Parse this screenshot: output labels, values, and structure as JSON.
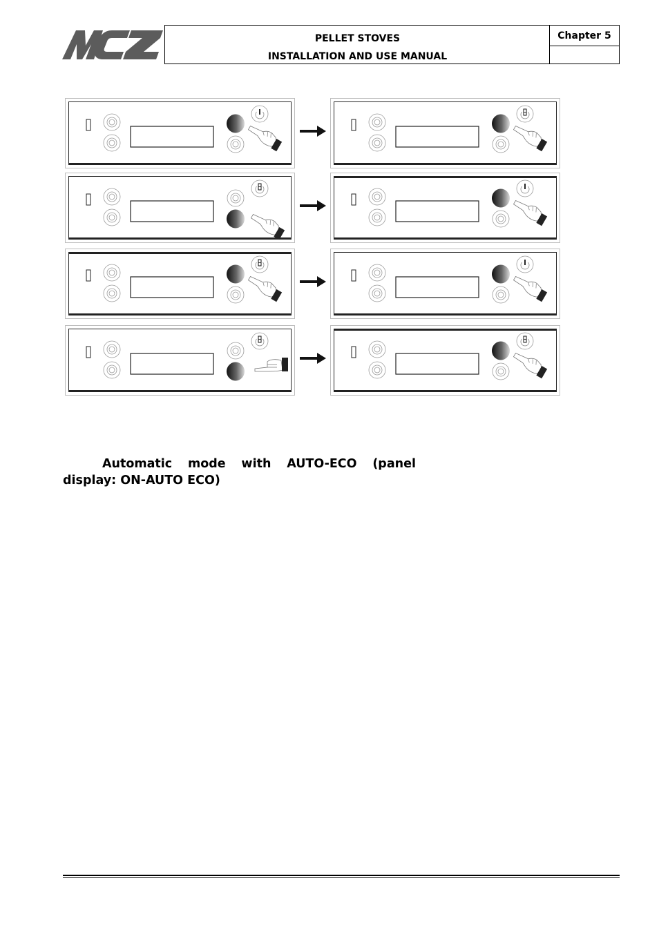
{
  "header": {
    "logo_text": "MCZ",
    "title_line1": "PELLET STOVES",
    "title_line2": "INSTALLATION AND USE MANUAL",
    "chapter": "Chapter 5"
  },
  "colors": {
    "logo": "#5c5c5c",
    "pressed_button_dark": "#1a1a1a",
    "outline_gray": "#9a9a9a",
    "border": "#222222"
  },
  "figure": {
    "description": "Control panel button sequence diagrams",
    "steps": [
      {
        "before": {
          "dark_button": "right-top",
          "hand": "pointing-left",
          "power_icon": "power-on"
        },
        "after": {
          "dark_button": "right-top",
          "hand": "pointing-left",
          "power_icon": "power-standby"
        }
      },
      {
        "before": {
          "dark_button": "right-bottom",
          "hand": "pointing-left",
          "power_icon": "power-standby"
        },
        "after": {
          "dark_button": "right-top",
          "hand": "pointing-left",
          "power_icon": "power-on"
        }
      },
      {
        "before": {
          "dark_button": "right-top",
          "hand": "pointing-left",
          "power_icon": "power-standby"
        },
        "after": {
          "dark_button": "right-top",
          "hand": "pointing-left",
          "power_icon": "power-on"
        }
      },
      {
        "before": {
          "dark_button": "right-bottom",
          "hand": "pointing-left-flat",
          "power_icon": "power-standby"
        },
        "after": {
          "dark_button": "right-top",
          "hand": "pointing-left",
          "power_icon": "power-standby"
        }
      }
    ],
    "arrow_icon": "arrow-right-icon"
  },
  "section": {
    "heading_words_line1": [
      "Automatic",
      "mode",
      "with",
      "AUTO-ECO",
      "(panel"
    ],
    "heading_line2": "display: ON-AUTO ECO)"
  }
}
